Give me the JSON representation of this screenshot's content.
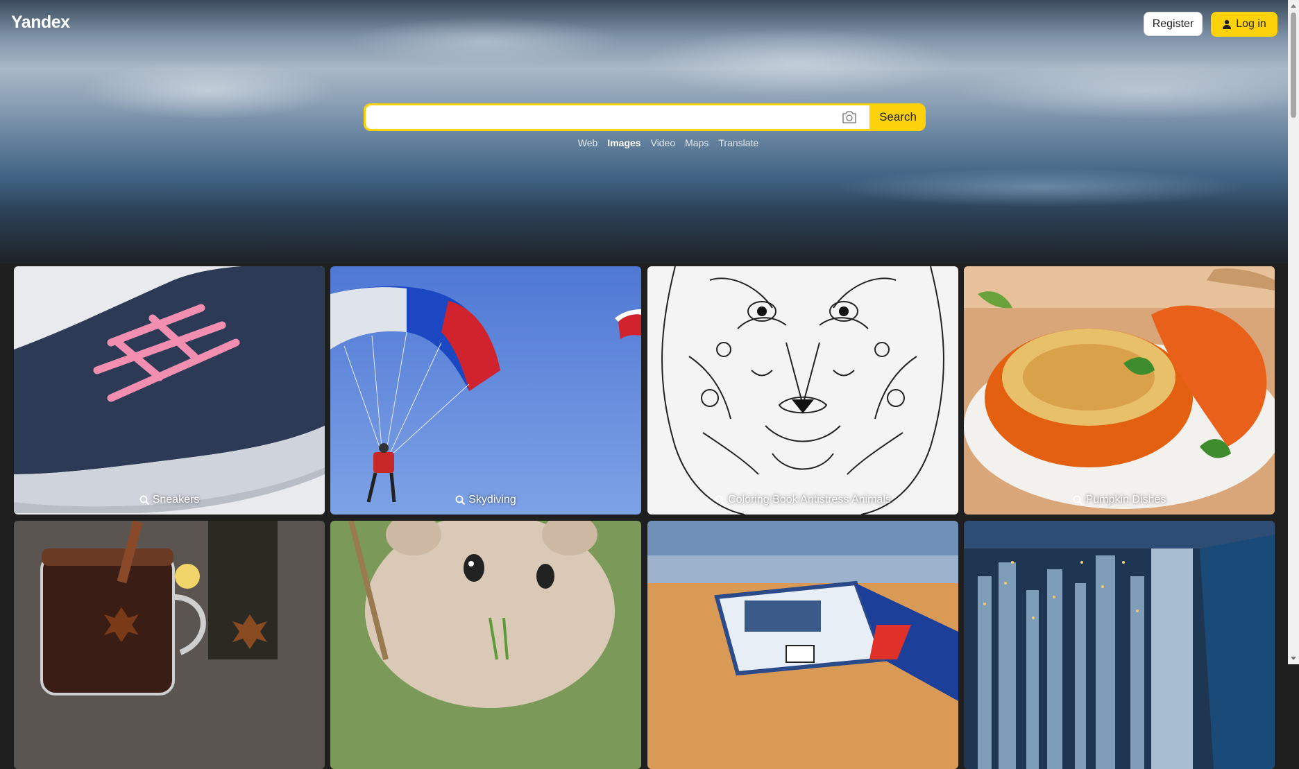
{
  "header": {
    "logo": "Yandex",
    "register_label": "Register",
    "login_label": "Log in"
  },
  "search": {
    "value": "",
    "placeholder": "",
    "button_label": "Search"
  },
  "services": [
    {
      "label": "Web",
      "active": false
    },
    {
      "label": "Images",
      "active": true
    },
    {
      "label": "Video",
      "active": false
    },
    {
      "label": "Maps",
      "active": false
    },
    {
      "label": "Translate",
      "active": false
    }
  ],
  "tiles": [
    {
      "caption": "Sneakers"
    },
    {
      "caption": "Skydiving"
    },
    {
      "caption": "Coloring Book Antistress Animals"
    },
    {
      "caption": "Pumpkin Dishes"
    },
    {
      "caption": ""
    },
    {
      "caption": ""
    },
    {
      "caption": ""
    },
    {
      "caption": ""
    }
  ],
  "colors": {
    "accent_yellow": "#fdd20a",
    "page_background": "#1f1f1f"
  },
  "icons": {
    "login": "user-icon",
    "search_image": "camera-icon",
    "tile_caption": "search-icon"
  }
}
